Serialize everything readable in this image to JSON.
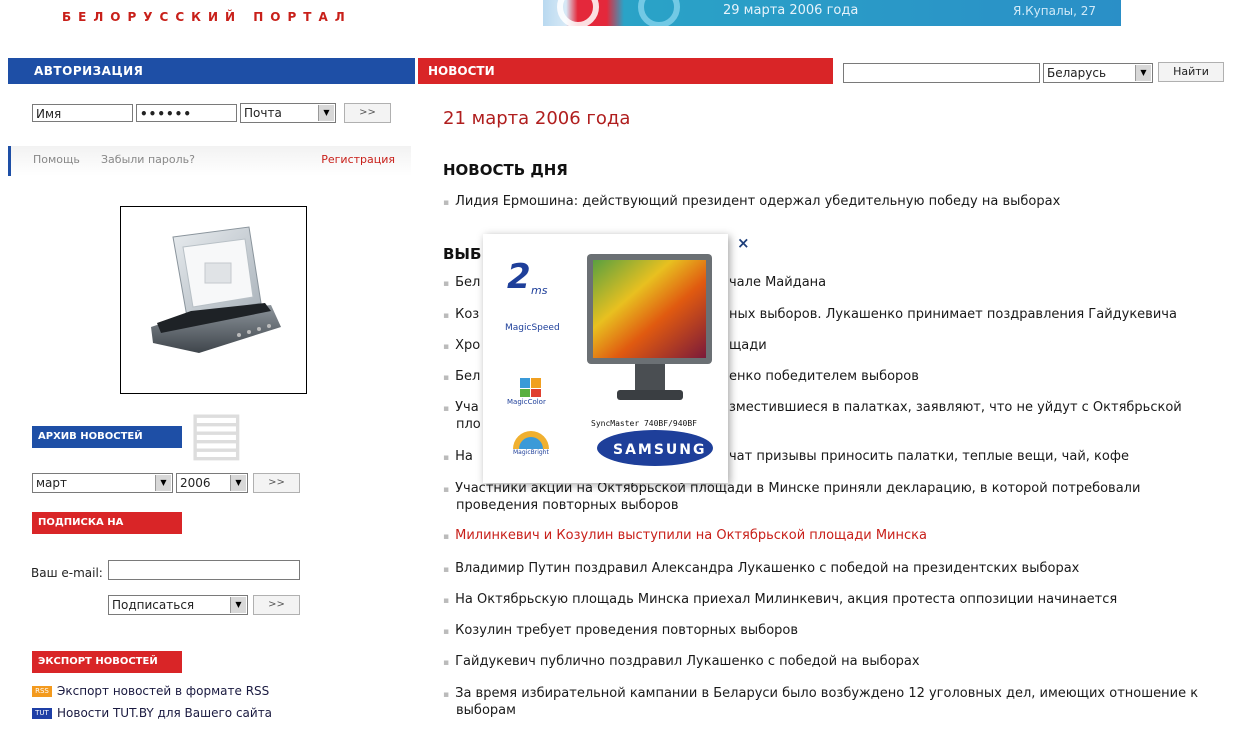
{
  "header": {
    "logo_text": "БЕЛОРУССКИЙ ПОРТАЛ",
    "banner_date": "29 марта 2006 года",
    "banner_address": "Я.Купалы, 27"
  },
  "auth": {
    "title": "АВТОРИЗАЦИЯ",
    "name_value": "Имя",
    "password_value": "••••••",
    "mail_select": "Почта",
    "go_label": ">>",
    "help_link": "Помощь",
    "forgot_link": "Забыли пароль?",
    "register_link": "Регистрация"
  },
  "archive": {
    "title": "АРХИВ НОВОСТЕЙ",
    "month": "март",
    "year": "2006",
    "go_label": ">>"
  },
  "subscribe": {
    "title": "ПОДПИСКА НА НОВОСТИ",
    "email_label": "Ваш e-mail:",
    "action_select": "Подписаться",
    "go_label": ">>"
  },
  "export": {
    "title": "ЭКСПОРТ НОВОСТЕЙ",
    "rss_icon": "RSS",
    "rss_link": "Экспорт новостей в формате RSS",
    "tut_icon": "TUT",
    "tut_link": "Новости TUT.BY для Вашего сайта"
  },
  "news": {
    "title": "НОВОСТИ",
    "region_select": "Беларусь",
    "find_button": "Найти",
    "date": "21 марта 2006 года",
    "day_head": "НОВОСТЬ ДНЯ",
    "day_item": "Лидия Ермошина: действующий президент одержал убедительную победу на выборах",
    "section_head": "ВЫБ",
    "items": [
      {
        "text": "Бел",
        "tail": "чале Майдана"
      },
      {
        "text": "Коз",
        "tail": "ных выборов. Лукашенко принимает поздравления Гайдукевича"
      },
      {
        "text": "Хро",
        "tail": "щади"
      },
      {
        "text": "Бел",
        "tail": "енко победителем выборов"
      },
      {
        "text": "Уча",
        "tail": "зместившиеся в палатках, заявляют, что не уйдут с Октябрьской"
      },
      {
        "text": "пло",
        "tail": ""
      },
      {
        "text": "На ",
        "tail": "чат призывы приносить палатки, теплые вещи, чай, кофе"
      }
    ],
    "items_full": [
      "Участники акции на Октябрьской площади в Минске приняли декларацию, в которой потребовали",
      "проведения повторных выборов",
      "Милинкевич и Козулин выступили на Октябрьской площади Минска",
      "Владимир Путин поздравил Александра Лукашенко с победой на президентских выборах",
      "На Октябрьскую площадь Минска приехал Милинкевич, акция протеста оппозиции начинается",
      "Козулин требует проведения повторных выборов",
      "Гайдукевич публично поздравил Лукашенко с победой на выборах",
      "За время избирательной кампании в Беларуси было возбуждено 12 уголовных дел, имеющих отношение к",
      "выборам"
    ]
  },
  "ad": {
    "badge_ms": "2ms",
    "magic_speed": "MagicSpeed",
    "magic_color": "MagicColor",
    "magic_bright": "MagicBright",
    "model": "SyncMaster 740BF/940BF",
    "brand": "SAMSUNG",
    "close": "×"
  }
}
